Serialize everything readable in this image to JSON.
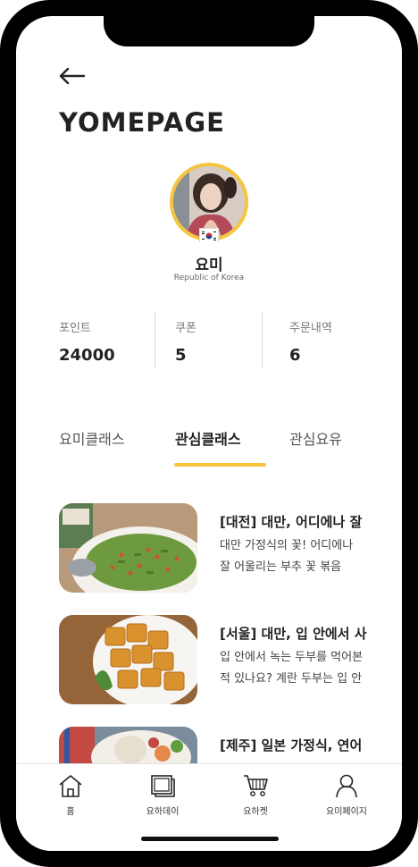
{
  "header": {
    "brand": "YOMEPAGE"
  },
  "profile": {
    "name": "요미",
    "country": "Republic of Korea"
  },
  "stats": [
    {
      "label": "포인트",
      "value": "24000"
    },
    {
      "label": "쿠폰",
      "value": "5"
    },
    {
      "label": "주문내역",
      "value": "6"
    }
  ],
  "tabs": [
    {
      "label": "요미클래스",
      "active": false
    },
    {
      "label": "관심클래스",
      "active": true
    },
    {
      "label": "관심요유",
      "active": false
    }
  ],
  "classes": [
    {
      "title": "[대전] 대만, 어디에나 잘",
      "desc_line1": "대만 가정식의 꽃! 어디에나",
      "desc_line2": "잘 어울리는 부추 꽃 볶음"
    },
    {
      "title": "[서울] 대만, 입 안에서 사",
      "desc_line1": "입 안에서 녹는 두부를 먹어본",
      "desc_line2": "적 있나요? 계란 두부는 입 안"
    },
    {
      "title": "[제주] 일본 가정식, 연어",
      "desc_line1": "",
      "desc_line2": ""
    }
  ],
  "nav": [
    {
      "label": "홈",
      "icon": "home-icon"
    },
    {
      "label": "요하데이",
      "icon": "photo-icon"
    },
    {
      "label": "요하켓",
      "icon": "cart-icon"
    },
    {
      "label": "요미페이지",
      "icon": "user-icon"
    }
  ],
  "colors": {
    "accent": "#f4c53d",
    "text": "#222222",
    "muted": "#777777"
  }
}
